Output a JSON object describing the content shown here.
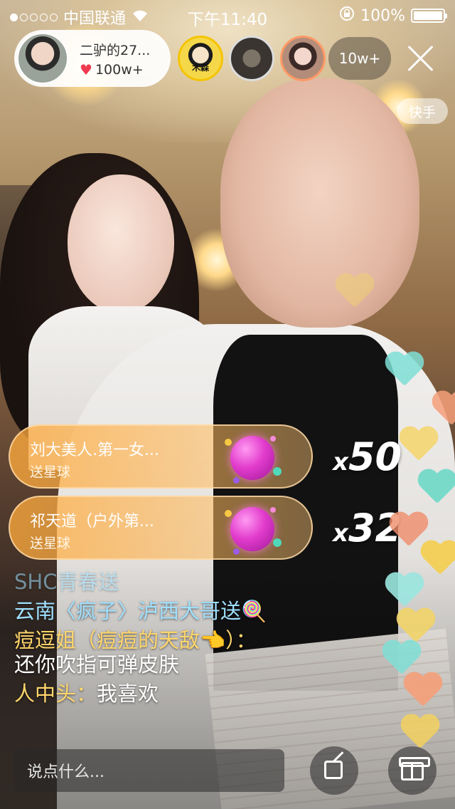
{
  "status_bar": {
    "carrier": "中国联通",
    "time": "下午11:40",
    "battery": "100%"
  },
  "host": {
    "name": "二驴的27...",
    "likes": "100w+"
  },
  "viewers": {
    "avatar1_label": "木森",
    "count": "10w+"
  },
  "brand_tag": "快手",
  "gifts": [
    {
      "sender": "刘大美人.第一女...",
      "action": "送星球",
      "count_prefix": "x",
      "count": "50"
    },
    {
      "sender": "祁天道（户外第...",
      "action": "送星球",
      "count_prefix": "x",
      "count": "32"
    }
  ],
  "comments": [
    {
      "text": "SHC青春送"
    },
    {
      "user": "云南〈疯子〉泸西大哥送",
      "text": "🍭"
    },
    {
      "user": "痘逗姐（痘痘的天敌👈）：",
      "text": "还你吹指可弹皮肤"
    },
    {
      "user": "人中头：",
      "text": "我喜欢"
    }
  ],
  "bottom_bar": {
    "input_placeholder": "说点什么..."
  },
  "heart_colors": [
    "#f2d46a",
    "#7fe0d6",
    "#f6a07a",
    "#f7d35b",
    "#6fd9c8",
    "#f08e6b",
    "#f5cf4f",
    "#9be6e0"
  ]
}
